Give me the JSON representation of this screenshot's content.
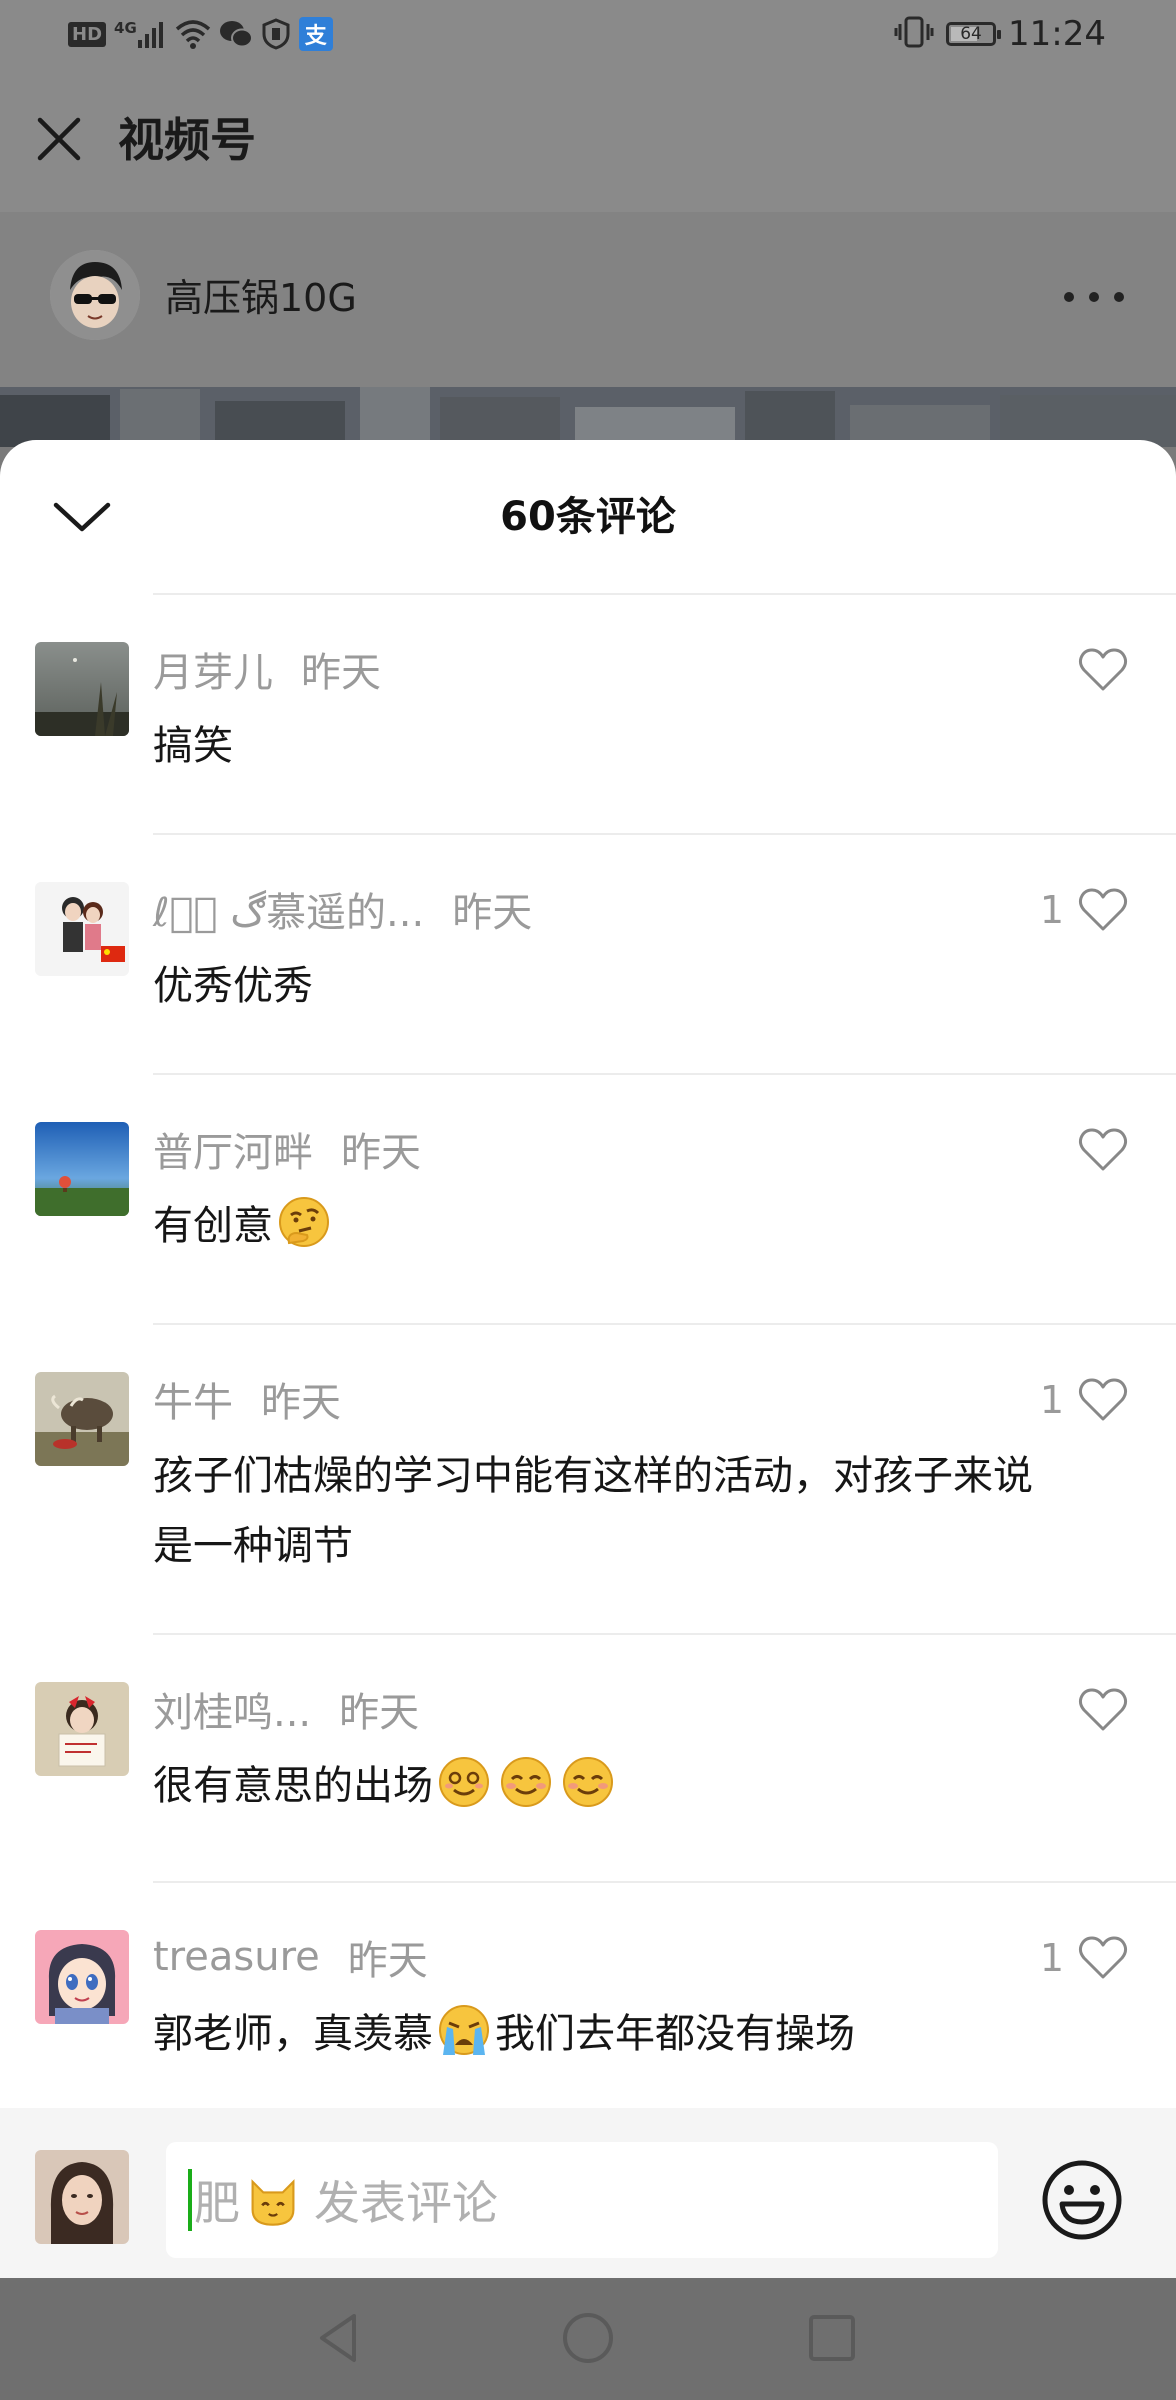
{
  "status_bar": {
    "left_icons": [
      "hd-icon",
      "signal-4g-icon",
      "wifi-icon",
      "wechat-icon",
      "shield-icon",
      "alipay-icon"
    ],
    "network_label": "4G",
    "hd_label": "HD",
    "alipay_label": "支",
    "battery_level": "64",
    "time": "11:24"
  },
  "header": {
    "close_icon": "close-icon",
    "title": "视频号"
  },
  "author": {
    "name": "高压锅10G",
    "more_icon": "more-dots-icon"
  },
  "comments_sheet": {
    "title": "60条评论",
    "collapse_icon": "chevron-down-icon",
    "comments": [
      {
        "user": "月芽儿",
        "time": "昨天",
        "text": "搞笑",
        "likes": ""
      },
      {
        "user": "ℓ؏ۭ ڰ慕遥的...",
        "time": "昨天",
        "text": "优秀优秀",
        "likes": "1"
      },
      {
        "user": "普厅河畔",
        "time": "昨天",
        "text": "有创意",
        "likes": ""
      },
      {
        "user": "牛牛",
        "time": "昨天",
        "text": "孩子们枯燥的学习中能有这样的活动，对孩子来说是一种调节",
        "likes": "1"
      },
      {
        "user": "刘桂鸣...",
        "time": "昨天",
        "text": "很有意思的出场",
        "likes": ""
      },
      {
        "user": "treasure",
        "time": "昨天",
        "text_a": "郭老师，真羡慕",
        "text_b": "我们去年都没有操场",
        "likes": "1"
      }
    ]
  },
  "input_bar": {
    "prefix": "肥",
    "placeholder": "发表评论",
    "emoji_button_icon": "smiley-icon"
  },
  "nav_bar": {
    "buttons": [
      "back-triangle-icon",
      "home-circle-icon",
      "recents-square-icon"
    ]
  },
  "colors": {
    "dim_overlay": "#8a8a8a",
    "sheet_bg": "#ffffff",
    "meta_gray": "#9a9a9a",
    "caret_green": "#1aad19",
    "input_bar_bg": "#f5f5f5"
  }
}
